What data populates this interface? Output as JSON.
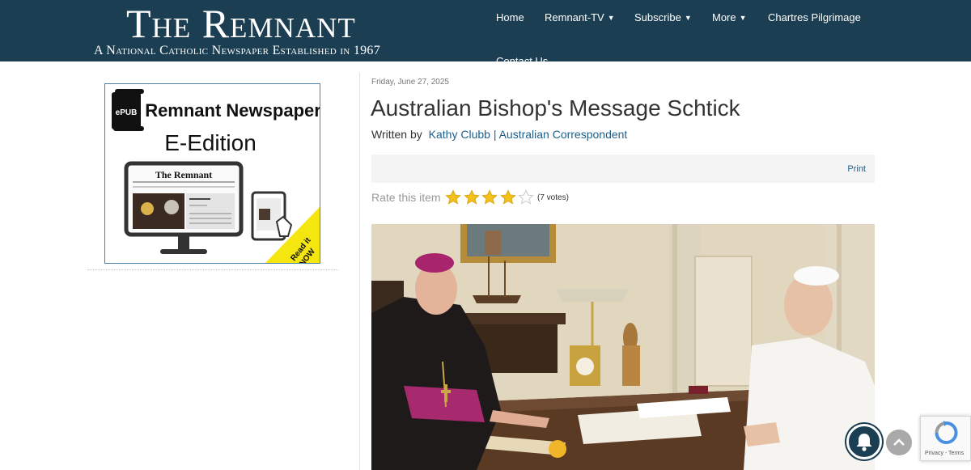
{
  "header": {
    "logo_title": "The Remnant",
    "logo_tagline": "A National Catholic Newspaper Established in 1967",
    "nav": [
      {
        "label": "Home"
      },
      {
        "label": "Remnant-TV"
      },
      {
        "label": "Subscribe"
      },
      {
        "label": "More"
      },
      {
        "label": "Chartres Pilgrimage"
      }
    ],
    "nav_overflow": "Contact Us"
  },
  "sidebar": {
    "banner": {
      "badge": "ePUB",
      "title": "Remnant Newspaper",
      "subtitle": "E-Edition",
      "masthead": "The Remnant",
      "corner_line1": "Read it",
      "corner_line2": "NOW"
    }
  },
  "article": {
    "date": "Friday, June 27, 2025",
    "title": "Australian Bishop's Message Schtick",
    "written_by": "Written by",
    "author": "Kathy Clubb | Australian Correspondent",
    "print": "Print",
    "rate_label": "Rate this item",
    "rating": 4,
    "max_rating": 5,
    "votes": "(7 votes)"
  },
  "widgets": {
    "recaptcha": "Privacy - Terms"
  },
  "colors": {
    "header_bg": "#1b3e52",
    "link": "#1c5f8c",
    "star": "#f2c21b"
  }
}
